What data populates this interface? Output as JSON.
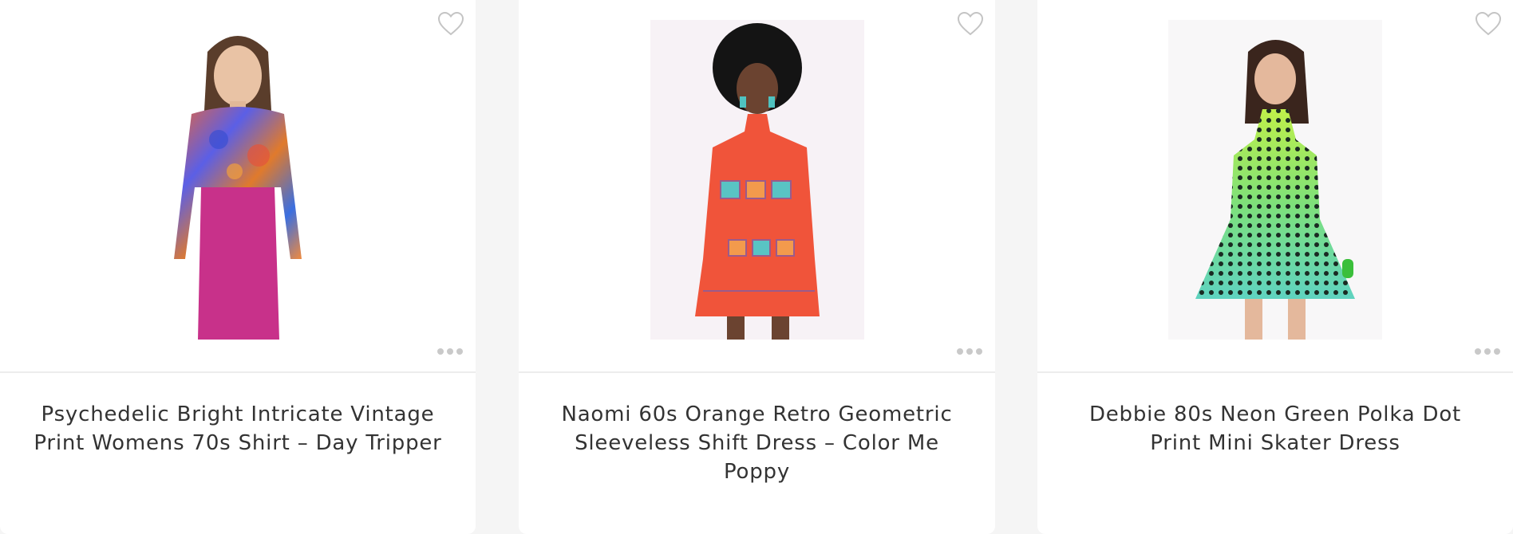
{
  "products": [
    {
      "title": "Psychedelic Bright Intricate Vintage Print Womens 70s Shirt – Day Tripper",
      "image_alt": "Model wearing a psychedelic print shirt and pink skirt",
      "wishlist_icon": "heart-outline-icon",
      "menu_icon": "more-dots-icon"
    },
    {
      "title": "Naomi 60s Orange Retro Geometric Sleeveless Shift Dress – Color Me Poppy",
      "image_alt": "Model wearing an orange halter shift dress with geometric squares",
      "wishlist_icon": "heart-outline-icon",
      "menu_icon": "more-dots-icon"
    },
    {
      "title": "Debbie 80s Neon Green Polka Dot Print Mini Skater Dress",
      "image_alt": "Model wearing a neon green polka dot halter skater dress",
      "wishlist_icon": "heart-outline-icon",
      "menu_icon": "more-dots-icon"
    }
  ],
  "colors": {
    "page_background": "#f5f5f5",
    "card_background": "#ffffff",
    "title_text": "#333333",
    "icon_grey": "#c9c9c9"
  }
}
